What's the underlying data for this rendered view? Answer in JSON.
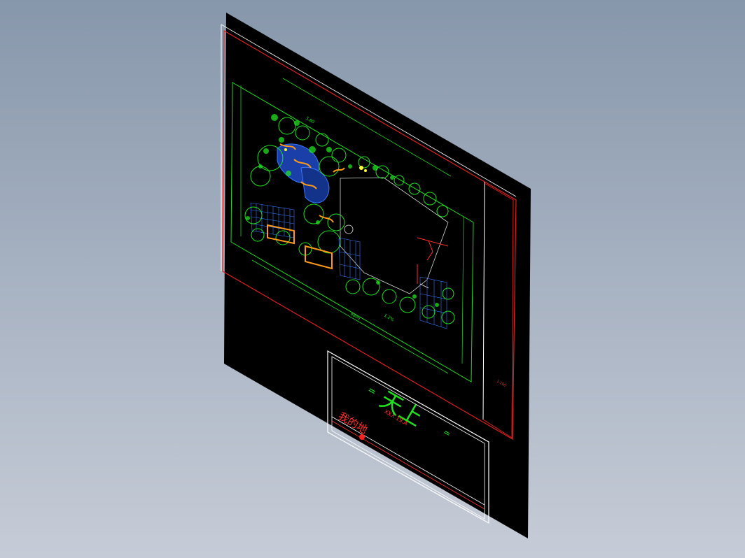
{
  "viewport": {
    "background_top": "#8797ab",
    "background_bottom": "#c6ccd7"
  },
  "drawing": {
    "sheet_color": "#000000",
    "frame_color": "#e02020",
    "outline_color": "#ffffff",
    "linework_color": "#20e020",
    "hatch_color": "#3a78ff",
    "accent_color": "#ff9a1a",
    "highlight_color": "#ffff33"
  },
  "title_block": {
    "main_title": "天上",
    "subtitle": "我的地",
    "code": "XXX 19.A",
    "tab_marks": "="
  },
  "plan_labels": {
    "label_a": "3.60",
    "label_b": "1.2%",
    "label_c": "4800"
  }
}
